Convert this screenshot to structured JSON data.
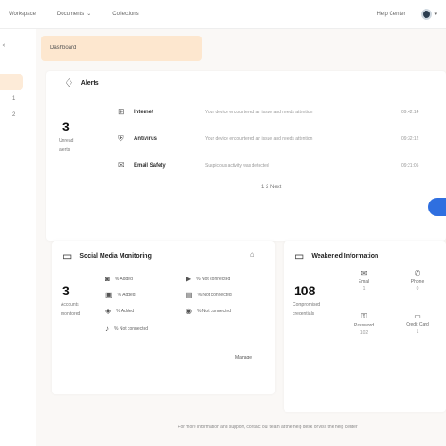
{
  "nav": {
    "items": [
      {
        "label": "Workspace",
        "caret": ""
      },
      {
        "label": "Documents",
        "caret": "⌄"
      },
      {
        "label": "Collections",
        "caret": ""
      }
    ],
    "help": "Help Center"
  },
  "rail": {
    "numbers": [
      "1",
      "2"
    ]
  },
  "banner": {
    "text": "Dashboard"
  },
  "alerts": {
    "title": "Alerts",
    "count": "3",
    "count_label_1": "Unread",
    "count_label_2": "alerts",
    "rows": [
      {
        "name": "Internet",
        "desc": "Your device encountered an issue and needs attention",
        "time": "09:42:14"
      },
      {
        "name": "Antivirus",
        "desc": "Your device encountered an issue and needs attention",
        "time": "09:32:12"
      },
      {
        "name": "Email Safety",
        "desc": "Suspicious activity was detected",
        "time": "09:21:05"
      }
    ],
    "pager": "1  2  Next"
  },
  "social": {
    "title": "Social Media Monitoring",
    "count": "3",
    "count_label_1": "Accounts",
    "count_label_2": "monitored",
    "items": [
      {
        "icon": "instagram-icon",
        "glyph": "◙",
        "label": "% Added"
      },
      {
        "icon": "facebook-icon",
        "glyph": "▣",
        "label": "% Added"
      },
      {
        "icon": "twitter-icon",
        "glyph": "◈",
        "label": "% Added"
      },
      {
        "icon": "youtube-icon",
        "glyph": "▶",
        "label": "% Not connected"
      },
      {
        "icon": "linkedin-icon",
        "glyph": "▤",
        "label": "% Not connected"
      },
      {
        "icon": "pinterest-icon",
        "glyph": "◉",
        "label": "% Not connected"
      },
      {
        "icon": "tiktok-icon",
        "glyph": "♪",
        "label": "% Not connected"
      }
    ],
    "manage": "Manage"
  },
  "weakness": {
    "title": "Weakened Information",
    "count": "108",
    "count_label_1": "Compromised",
    "count_label_2": "credentials",
    "items": [
      {
        "icon": "email-icon",
        "glyph": "✉",
        "label": "Email",
        "value": "1"
      },
      {
        "icon": "phone-icon",
        "glyph": "✆",
        "label": "Phone",
        "value": "0"
      },
      {
        "icon": "password-icon",
        "glyph": "⚿",
        "label": "Password",
        "value": "102"
      },
      {
        "icon": "credit-card-icon",
        "glyph": "▭",
        "label": "Credit Card",
        "value": "1"
      }
    ]
  },
  "footer": "For more information and support, contact our team at the help desk or visit the help center"
}
